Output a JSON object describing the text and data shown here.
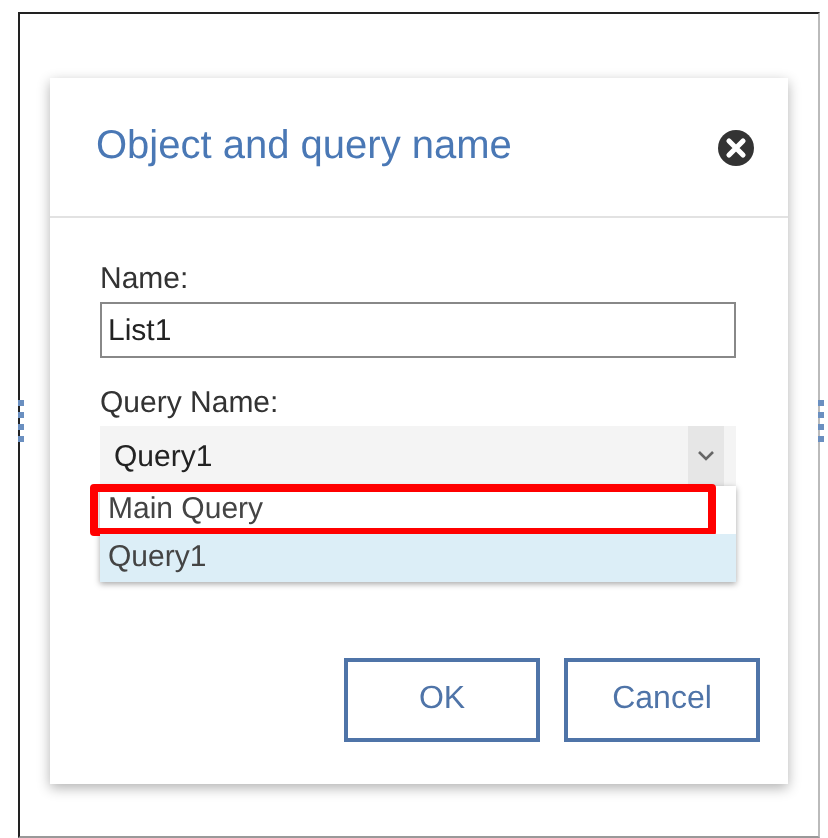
{
  "dialog": {
    "title": "Object and query name"
  },
  "name_field": {
    "label": "Name:",
    "value": "List1"
  },
  "query_field": {
    "label": "Query Name:",
    "value": "Query1",
    "expanded": true,
    "options": [
      {
        "label": "Main Query",
        "selected": false,
        "highlighted": true
      },
      {
        "label": "Query1",
        "selected": true,
        "highlighted": false
      }
    ]
  },
  "buttons": [
    "OK",
    "Cancel"
  ]
}
